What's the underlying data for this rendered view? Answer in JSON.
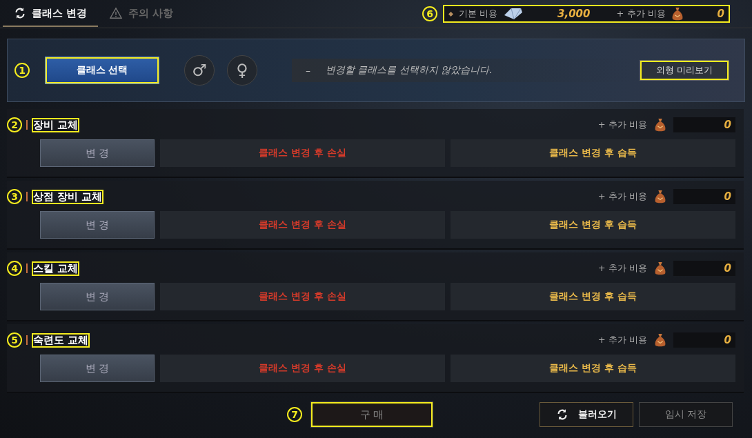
{
  "tabs": [
    {
      "label": "클래스 변경",
      "selected": true,
      "kind": "refresh"
    },
    {
      "label": "주의 사항",
      "selected": false,
      "kind": "warning"
    }
  ],
  "cost_bar": {
    "callout": "6",
    "highlighted": true,
    "base_label": "기본 비용",
    "base_value": "3,000",
    "extra_label": "+ 추가 비용",
    "extra_value": "0"
  },
  "class_panel": {
    "callout": "1",
    "select_button": {
      "label": "클래스 선택",
      "highlighted": true
    },
    "gender_buttons": [
      {
        "symbol": "♂"
      },
      {
        "symbol": "♀"
      }
    ],
    "dash": "–",
    "message": "변경할 클래스를 선택하지 않았습니다.",
    "preview_button": {
      "label": "외형 미리보기",
      "highlighted": true
    }
  },
  "sections": [
    {
      "callout": "2",
      "title": "장비 교체",
      "highlighted": true,
      "extra_label": "+ 추가 비용",
      "extra_value": "0",
      "change_button": "변 경",
      "loss_label": "클래스 변경 후 손실",
      "gain_label": "클래스 변경 후 습득"
    },
    {
      "callout": "3",
      "title": "상점 장비 교체",
      "highlighted": true,
      "extra_label": "+ 추가 비용",
      "extra_value": "0",
      "change_button": "변 경",
      "loss_label": "클래스 변경 후 손실",
      "gain_label": "클래스 변경 후 습득"
    },
    {
      "callout": "4",
      "title": "스킬 교체",
      "highlighted": true,
      "extra_label": "+ 추가 비용",
      "extra_value": "0",
      "change_button": "변 경",
      "loss_label": "클래스 변경 후 손실",
      "gain_label": "클래스 변경 후 습득"
    },
    {
      "callout": "5",
      "title": "숙련도 교체",
      "highlighted": true,
      "extra_label": "+ 추가 비용",
      "extra_value": "0",
      "change_button": "변 경",
      "loss_label": "클래스 변경 후 손실",
      "gain_label": "클래스 변경 후 습득"
    }
  ],
  "footer": {
    "callout": "7",
    "buy_button": {
      "label": "구 매",
      "highlighted": true
    },
    "load_button": "불러오기",
    "save_button": "임시 저장"
  }
}
